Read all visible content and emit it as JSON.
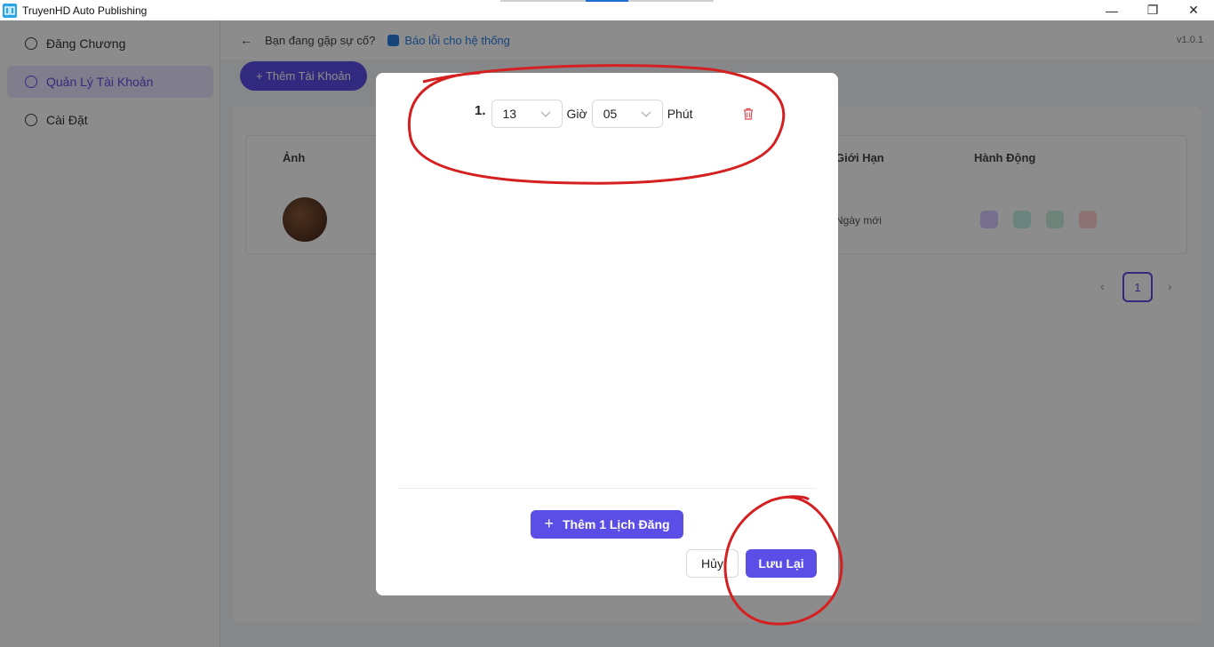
{
  "window": {
    "title": "TruyenHD Auto Publishing",
    "minimize_glyph": "—",
    "restore_glyph": "❐",
    "close_glyph": "✕"
  },
  "sidebar": {
    "items": [
      {
        "label": "Đăng Chương",
        "icon": "user-icon"
      },
      {
        "label": "Quản Lý Tài Khoản",
        "icon": "user-icon",
        "active": true
      },
      {
        "label": "Cài Đặt",
        "icon": "gear-icon"
      }
    ]
  },
  "topbar": {
    "back_glyph": "←",
    "question": "Bạn đang gặp sự cố?",
    "link": "Báo lỗi cho hệ thống",
    "version": "v1.0.1"
  },
  "main": {
    "add_account_label": "+ Thêm Tài Khoản",
    "table": {
      "headers": [
        "Ảnh",
        "Giới Hạn",
        "Hành Động"
      ],
      "row_limit": "Ngày mới"
    },
    "pager": {
      "current": "1",
      "prev": "‹",
      "next": "›"
    }
  },
  "modal": {
    "schedules": [
      {
        "index": "1.",
        "hour": "13",
        "hour_unit": "Giờ",
        "minute": "05",
        "minute_unit": "Phút"
      }
    ],
    "add_schedule_label": "Thêm 1 Lịch Đăng",
    "add_icon": "+",
    "cancel_label": "Hủy",
    "save_label": "Lưu Lại"
  },
  "colors": {
    "accent": "#5b4ee6",
    "danger": "#e5484d",
    "annotation": "#d42020"
  }
}
